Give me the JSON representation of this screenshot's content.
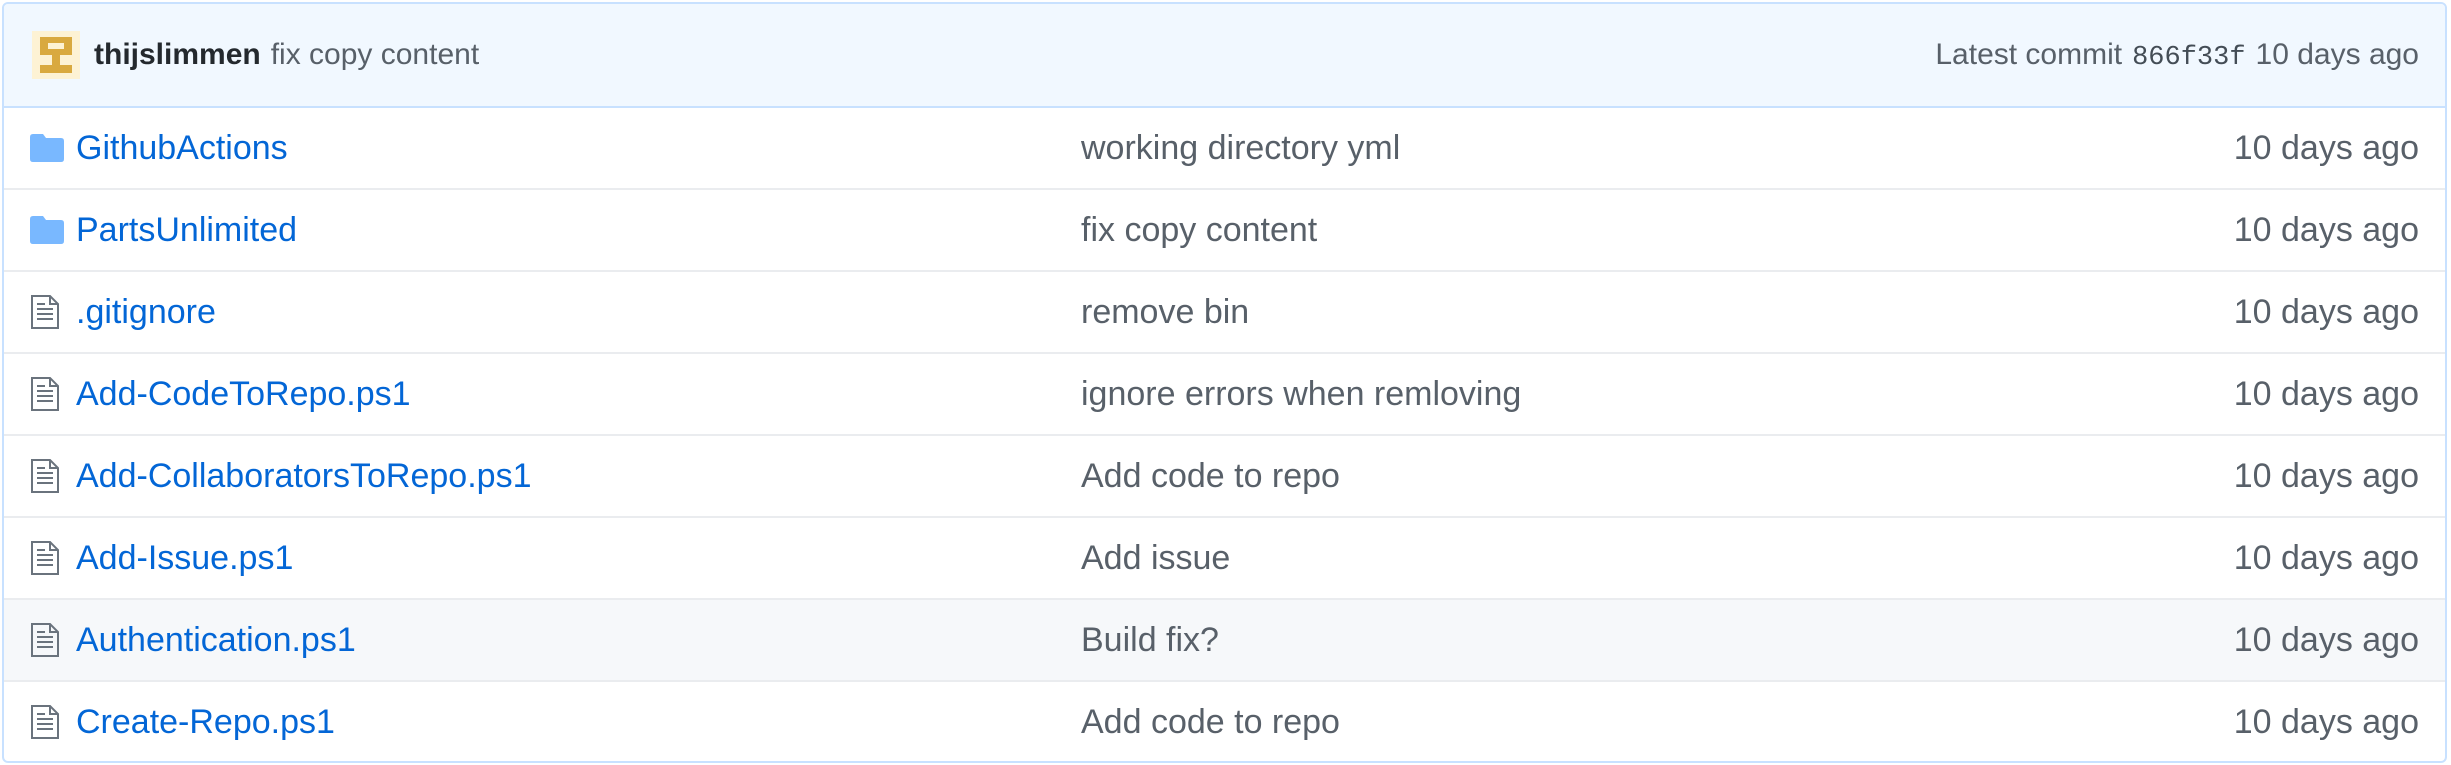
{
  "latest_commit": {
    "author": "thijslimmen",
    "message": "fix copy content",
    "label": "Latest commit",
    "sha": "866f33f",
    "age": "10 days ago"
  },
  "colors": {
    "link": "#0366d6",
    "muted": "#586069",
    "folder_icon": "#79b8ff",
    "commit_bar_bg": "#f1f8ff"
  },
  "files": [
    {
      "type": "folder",
      "icon": "folder-icon",
      "name": "GithubActions",
      "message": "working directory yml",
      "age": "10 days ago"
    },
    {
      "type": "folder",
      "icon": "folder-icon",
      "name": "PartsUnlimited",
      "message": "fix copy content",
      "age": "10 days ago"
    },
    {
      "type": "file",
      "icon": "file-icon",
      "name": ".gitignore",
      "message": "remove bin",
      "age": "10 days ago"
    },
    {
      "type": "file",
      "icon": "file-icon",
      "name": "Add-CodeToRepo.ps1",
      "message": "ignore errors when remloving",
      "age": "10 days ago"
    },
    {
      "type": "file",
      "icon": "file-icon",
      "name": "Add-CollaboratorsToRepo.ps1",
      "message": "Add code to repo",
      "age": "10 days ago"
    },
    {
      "type": "file",
      "icon": "file-icon",
      "name": "Add-Issue.ps1",
      "message": "Add issue",
      "age": "10 days ago"
    },
    {
      "type": "file",
      "icon": "file-icon",
      "name": "Authentication.ps1",
      "message": "Build fix?",
      "age": "10 days ago"
    },
    {
      "type": "file",
      "icon": "file-icon",
      "name": "Create-Repo.ps1",
      "message": "Add code to repo",
      "age": "10 days ago"
    }
  ]
}
